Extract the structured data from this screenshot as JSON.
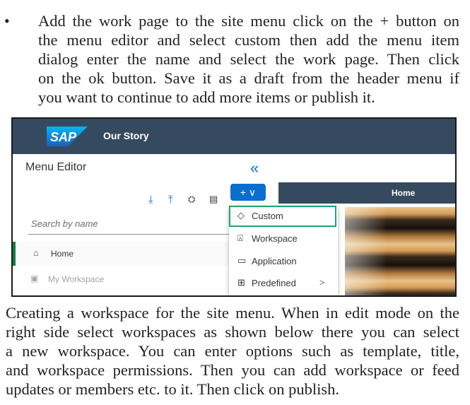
{
  "paragraph1": {
    "bullet": "•",
    "lines": [
      "Add the work page to the site menu click on the + button on",
      "the menu editor and select custom then add the menu item",
      "dialog enter the name and select the work page. Then click",
      "on the ok button.  Save it as a draft from the header menu if",
      "you want to continue to add more items or publish it."
    ]
  },
  "screenshot": {
    "logo_text": "SAP",
    "site_title": "Our Story",
    "editor_title": "Menu Editor",
    "collapse_glyph": "«",
    "toolbar": {
      "download": "⤓",
      "upload": "⤒",
      "filter": "⛭",
      "card": "▤"
    },
    "search_placeholder": "Search by name",
    "add_button": "+ ∨",
    "nav_items": [
      {
        "icon": "⌂",
        "label": "Home"
      },
      {
        "icon": "▣",
        "label": "My Workspace"
      }
    ],
    "header_tab": "Home",
    "dropdown": [
      {
        "icon": "◇",
        "label": "Custom"
      },
      {
        "icon": "⍓",
        "label": "Workspace"
      },
      {
        "icon": "▭",
        "label": "Application"
      },
      {
        "icon": "⊞",
        "label": "Predefined",
        "arrow": ">"
      }
    ]
  },
  "paragraph2": {
    "lines": [
      "Creating a workspace for the site menu. When in edit mode on the",
      "right side select workspaces as shown below there you can select",
      "a new workspace. You can enter options such as template, title,",
      "and workspace permissions. Then you can add workspace or feed",
      "updates or members etc. to it. Then click on publish."
    ]
  },
  "colors": {
    "shell": "#354a5f",
    "accent": "#0a6ed1",
    "highlight": "#25a07a"
  }
}
